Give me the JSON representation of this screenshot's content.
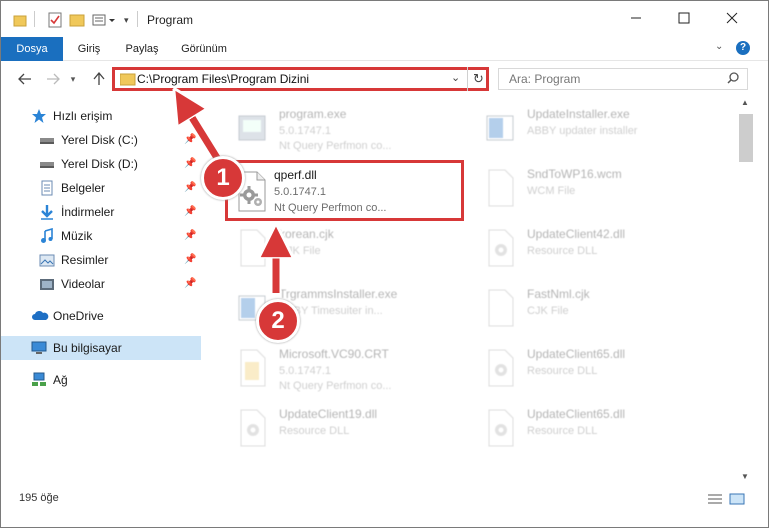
{
  "window": {
    "title": "Program"
  },
  "ribbon": {
    "tabs": [
      "Dosya",
      "Giriş",
      "Paylaş",
      "Görünüm"
    ]
  },
  "address": {
    "path": "C:\\Program Files\\Program Dizini",
    "search_placeholder": "Ara: Program"
  },
  "sidebar": {
    "items": [
      {
        "label": "Hızlı erişim",
        "icon": "star-icon"
      },
      {
        "label": "Yerel Disk (C:)",
        "icon": "drive-icon",
        "pinned": true
      },
      {
        "label": "Yerel Disk (D:)",
        "icon": "drive-icon",
        "pinned": true
      },
      {
        "label": "Belgeler",
        "icon": "documents-icon",
        "pinned": true
      },
      {
        "label": "İndirmeler",
        "icon": "download-icon",
        "pinned": true
      },
      {
        "label": "Müzik",
        "icon": "music-icon",
        "pinned": true
      },
      {
        "label": "Resimler",
        "icon": "pictures-icon",
        "pinned": true
      },
      {
        "label": "Videolar",
        "icon": "videos-icon",
        "pinned": true
      },
      {
        "label": "OneDrive",
        "icon": "cloud-icon"
      },
      {
        "label": "Bu bilgisayar",
        "icon": "computer-icon",
        "selected": true
      },
      {
        "label": "Ağ",
        "icon": "network-icon"
      }
    ]
  },
  "files": [
    {
      "name": "program.exe",
      "line1": "5.0.1747.1",
      "line2": "Nt Query Perfmon co...",
      "icon": "exe-icon"
    },
    {
      "name": "UpdateInstaller.exe",
      "line1": "ABBY updater installer",
      "line2": "",
      "icon": "exe-icon"
    },
    {
      "name": "qperf.dll",
      "line1": "5.0.1747.1",
      "line2": "Nt Query Perfmon co...",
      "icon": "dll-gear-icon",
      "highlight": true
    },
    {
      "name": "SndToWP16.wcm",
      "line1": "WCM File",
      "line2": "",
      "icon": "file-icon"
    },
    {
      "name": "korean.cjk",
      "line1": "CJK File",
      "line2": "",
      "icon": "file-icon"
    },
    {
      "name": "UpdateClient42.dll",
      "line1": "Resource DLL",
      "line2": "",
      "icon": "dll-gear-icon"
    },
    {
      "name": "TrgrammsInstaller.exe",
      "line1": "ABBY Timesuiter in...",
      "line2": "",
      "icon": "exe-icon"
    },
    {
      "name": "FastNml.cjk",
      "line1": "CJK File",
      "line2": "",
      "icon": "file-icon"
    },
    {
      "name": "Microsoft.VC90.CRT",
      "line1": "5.0.1747.1",
      "line2": "Nt Query Perfmon co...",
      "icon": "folder-doc-icon"
    },
    {
      "name": "UpdateClient65.dll",
      "line1": "Resource DLL",
      "line2": "",
      "icon": "dll-gear-icon"
    },
    {
      "name": "UpdateClient19.dll",
      "line1": "Resource DLL",
      "line2": "",
      "icon": "dll-gear-icon"
    },
    {
      "name": "UpdateClient65.dll",
      "line1": "Resource DLL",
      "line2": "",
      "icon": "dll-gear-icon"
    }
  ],
  "status": {
    "count": "195 öğe"
  },
  "annotations": {
    "badge1": "1",
    "badge2": "2"
  },
  "colors": {
    "accent": "#1a6fbf",
    "highlight": "#d73838",
    "selected_bg": "#cce4f7"
  }
}
